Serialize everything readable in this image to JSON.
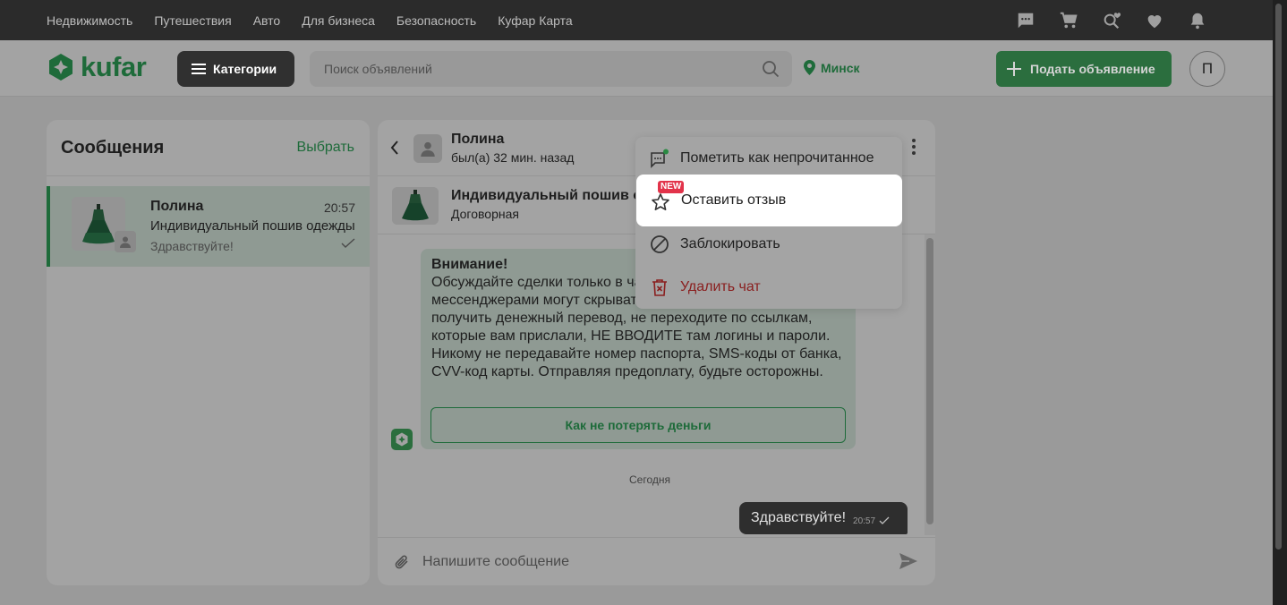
{
  "topnav": {
    "items": [
      "Недвижимость",
      "Путешествия",
      "Авто",
      "Для бизнеса",
      "Безопасность",
      "Куфар Карта"
    ]
  },
  "topicons": [
    "chat-icon",
    "cart-icon",
    "saved-search-icon",
    "heart-icon",
    "bell-icon"
  ],
  "header": {
    "logo_text": "kufar",
    "categories_label": "Категории",
    "search_placeholder": "Поиск объявлений",
    "city": "Минск",
    "post_ad_label": "Подать объявление",
    "avatar_letter": "П"
  },
  "messages": {
    "title": "Сообщения",
    "select_label": "Выбрать",
    "conversations": [
      {
        "name": "Полина",
        "time": "20:57",
        "subject": "Индивидуальный пошив одежды",
        "last_message": "Здравствуйте!"
      }
    ]
  },
  "chat": {
    "contact_name": "Полина",
    "contact_status": "был(а) 32 мин. назад",
    "ad_title": "Индивидуальный пошив о",
    "ad_price": "Договорная",
    "warning_title": "Внимание!",
    "warning_text": "Обсуждайте сделки только в чате Куфара. За другими мессенджерами могут скрываться мошенники. Чтобы получить денежный перевод, не переходите по ссылкам, которые вам прислали, НЕ ВВОДИТЕ там логины и пароли. Никому не передавайте номер паспорта, SMS-коды от банка, CVV-код карты. Отправляя предоплату, будьте осторожны.",
    "warning_button": "Как не потерять деньги",
    "day_label": "Сегодня",
    "outgoing_text": "Здравствуйте!",
    "outgoing_time": "20:57",
    "composer_placeholder": "Напишите сообщение"
  },
  "menu": {
    "mark_unread": "Пометить как непрочитанное",
    "new_badge": "NEW",
    "leave_review": "Оставить отзыв",
    "block": "Заблокировать",
    "delete_chat": "Удалить чат"
  },
  "colors": {
    "brand_green": "#1e6b3a",
    "danger_red": "#8a1e1e",
    "badge_red": "#e2334a"
  }
}
